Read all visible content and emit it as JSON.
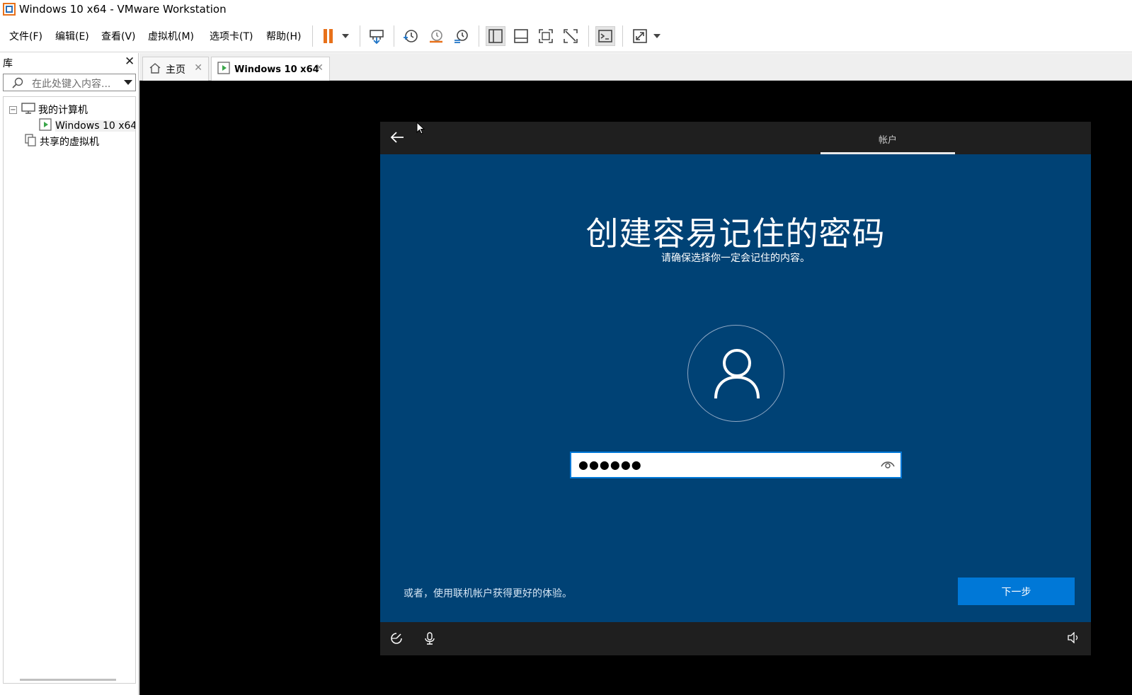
{
  "window": {
    "title": "Windows 10 x64 - VMware Workstation",
    "app_icon": "vmware-icon"
  },
  "menu": {
    "items": [
      "文件(F)",
      "编辑(E)",
      "查看(V)",
      "虚拟机(M)",
      "选项卡(T)",
      "帮助(H)"
    ]
  },
  "toolbar": {
    "icons": [
      "pause-icon",
      "dropdown-arrow-icon",
      "send-ctrl-alt-del-icon",
      "snapshot-icon",
      "revert-snapshot-icon",
      "snapshot-manager-icon",
      "show-library-icon",
      "thumbnail-bar-icon",
      "fullscreen-icon",
      "unity-icon",
      "console-view-icon",
      "stretch-icon"
    ],
    "accent": "#e8711a"
  },
  "library": {
    "title": "库",
    "search_placeholder": "在此处键入内容...",
    "tree": {
      "my_computer": "我的计算机",
      "vm": "Windows 10 x64",
      "shared": "共享的虚拟机"
    }
  },
  "tabs": {
    "home": "主页",
    "vm": "Windows 10 x64"
  },
  "guest": {
    "section": "帐户",
    "title": "创建容易记住的密码",
    "subtitle": "请确保选择你一定会记住的内容。",
    "password_mask": "●●●●●●",
    "alt_link": "或者，使用联机帐户获得更好的体验。",
    "next": "下一步",
    "background": "#004275",
    "button_color": "#0078d7"
  }
}
